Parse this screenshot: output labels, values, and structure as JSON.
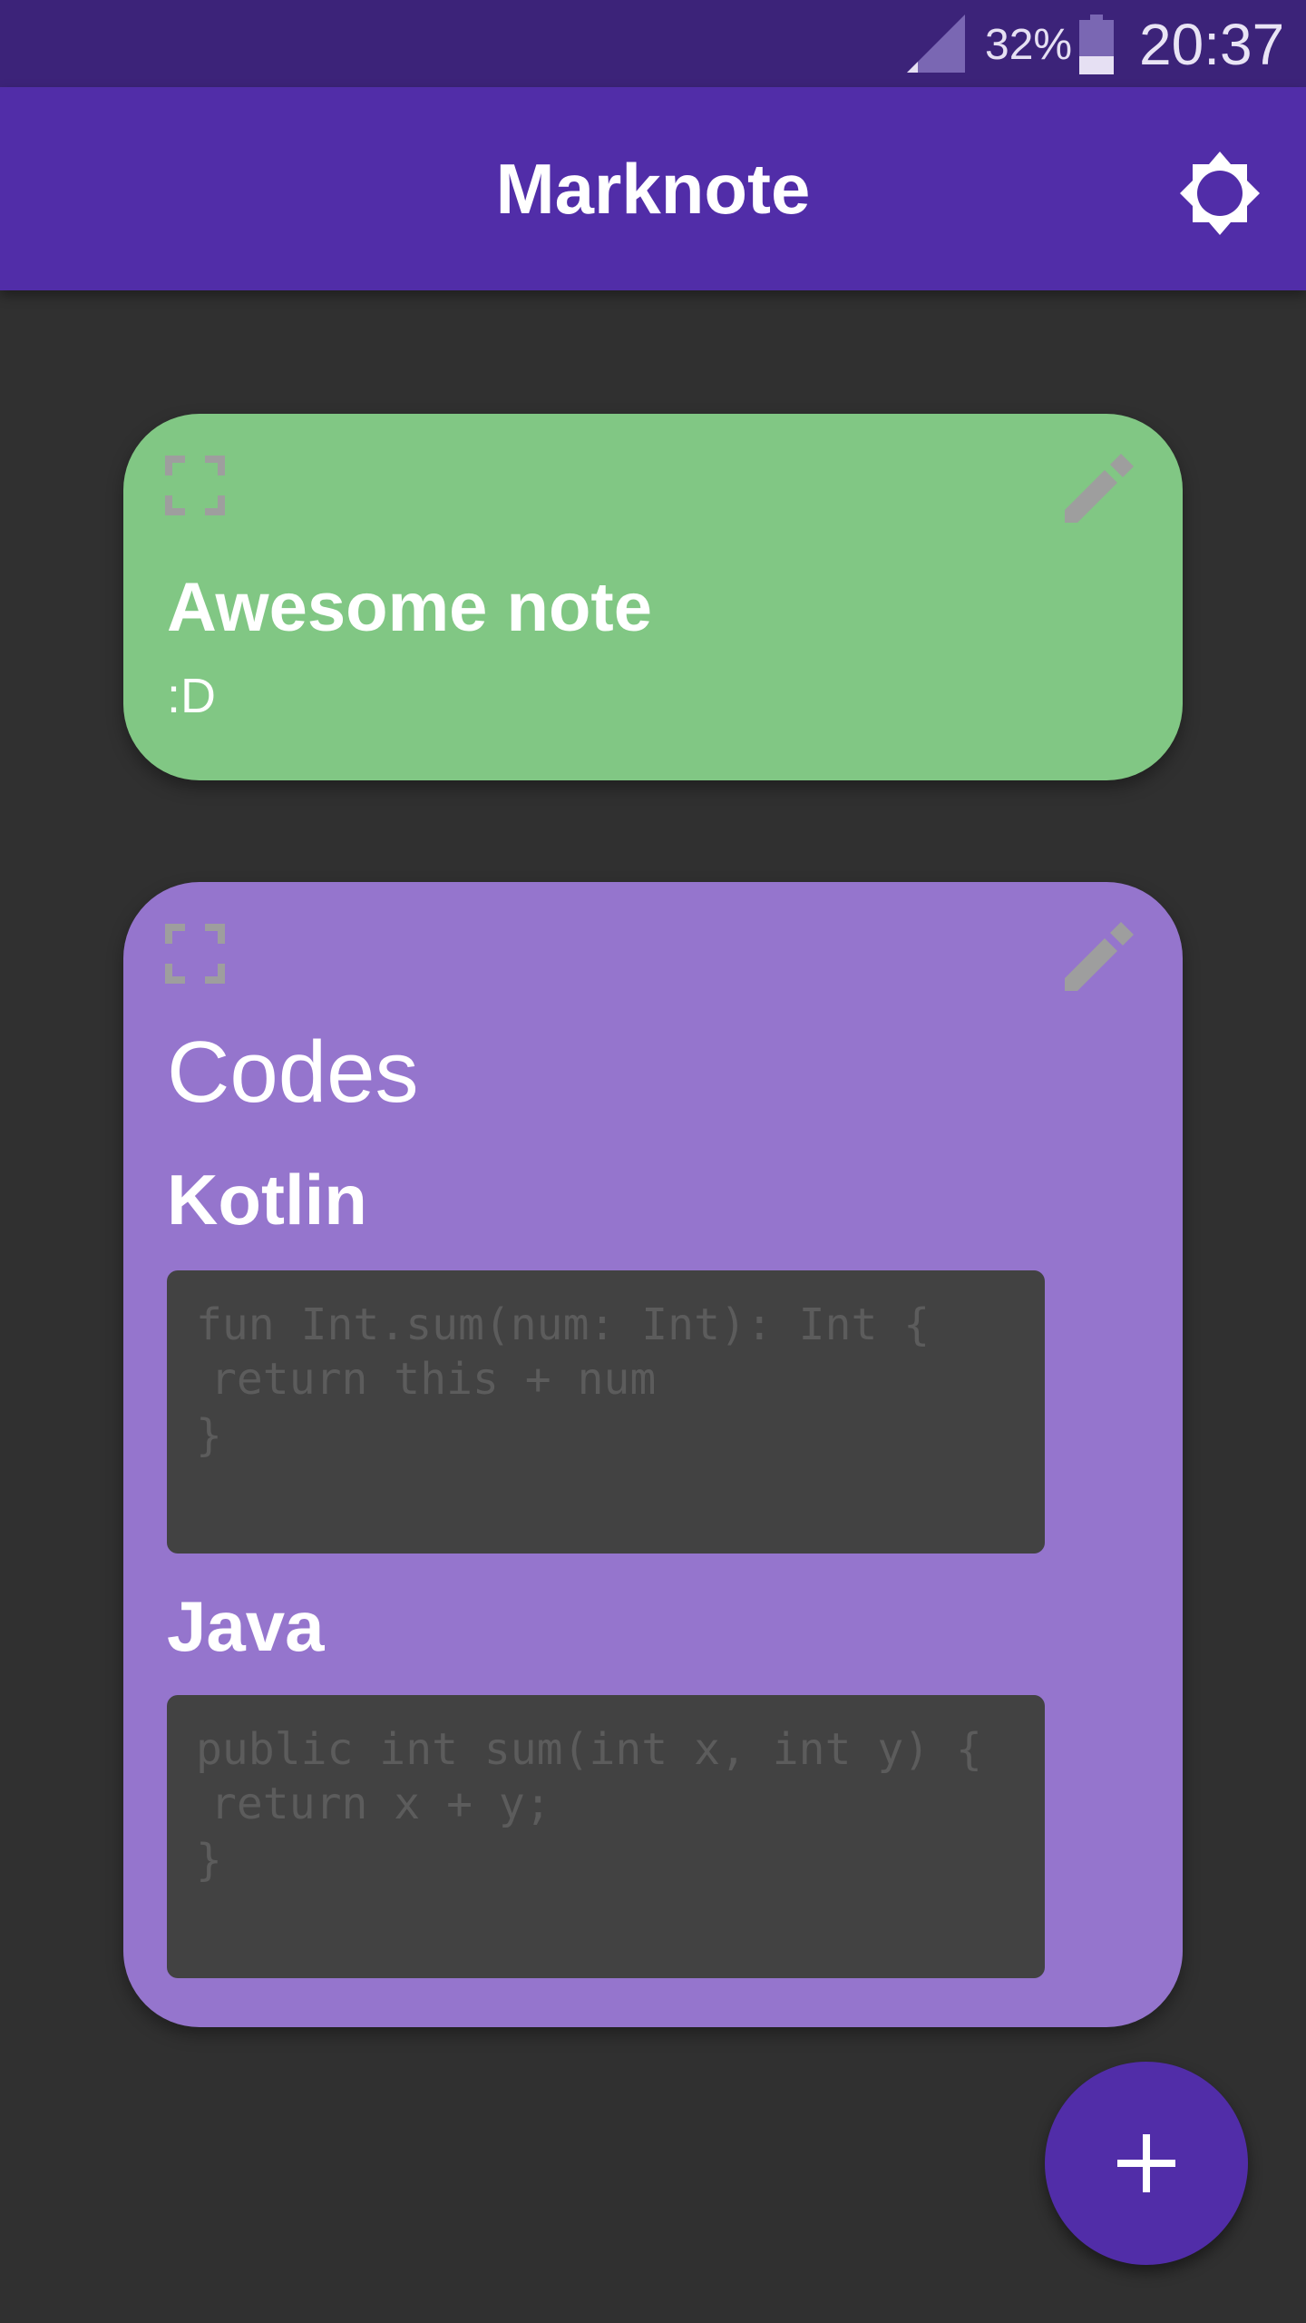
{
  "status_bar": {
    "signal_icon": "signal-icon",
    "battery_percent": "32%",
    "battery_icon": "battery-icon",
    "time": "20:37"
  },
  "app_bar": {
    "title": "Marknote",
    "settings_icon": "brightness-gear-icon"
  },
  "notes": [
    {
      "color": "#81c784",
      "expand_icon": "expand-icon",
      "edit_icon": "edit-pencil-icon",
      "title": "Awesome note",
      "body": ":D"
    },
    {
      "color": "#9575cd",
      "expand_icon": "expand-icon",
      "edit_icon": "edit-pencil-icon",
      "title": "Codes",
      "sections": [
        {
          "heading": "Kotlin",
          "code": [
            "fun Int.sum(num: Int): Int {",
            "return this + num",
            "}"
          ]
        },
        {
          "heading": "Java",
          "code": [
            "public int sum(int x, int y) {",
            "return x + y;",
            "}"
          ]
        }
      ]
    }
  ],
  "fab": {
    "icon": "plus-icon"
  },
  "colors": {
    "status_bar": "#3c2379",
    "app_bar": "#512da8",
    "background": "#303030",
    "code_background": "#424242"
  }
}
